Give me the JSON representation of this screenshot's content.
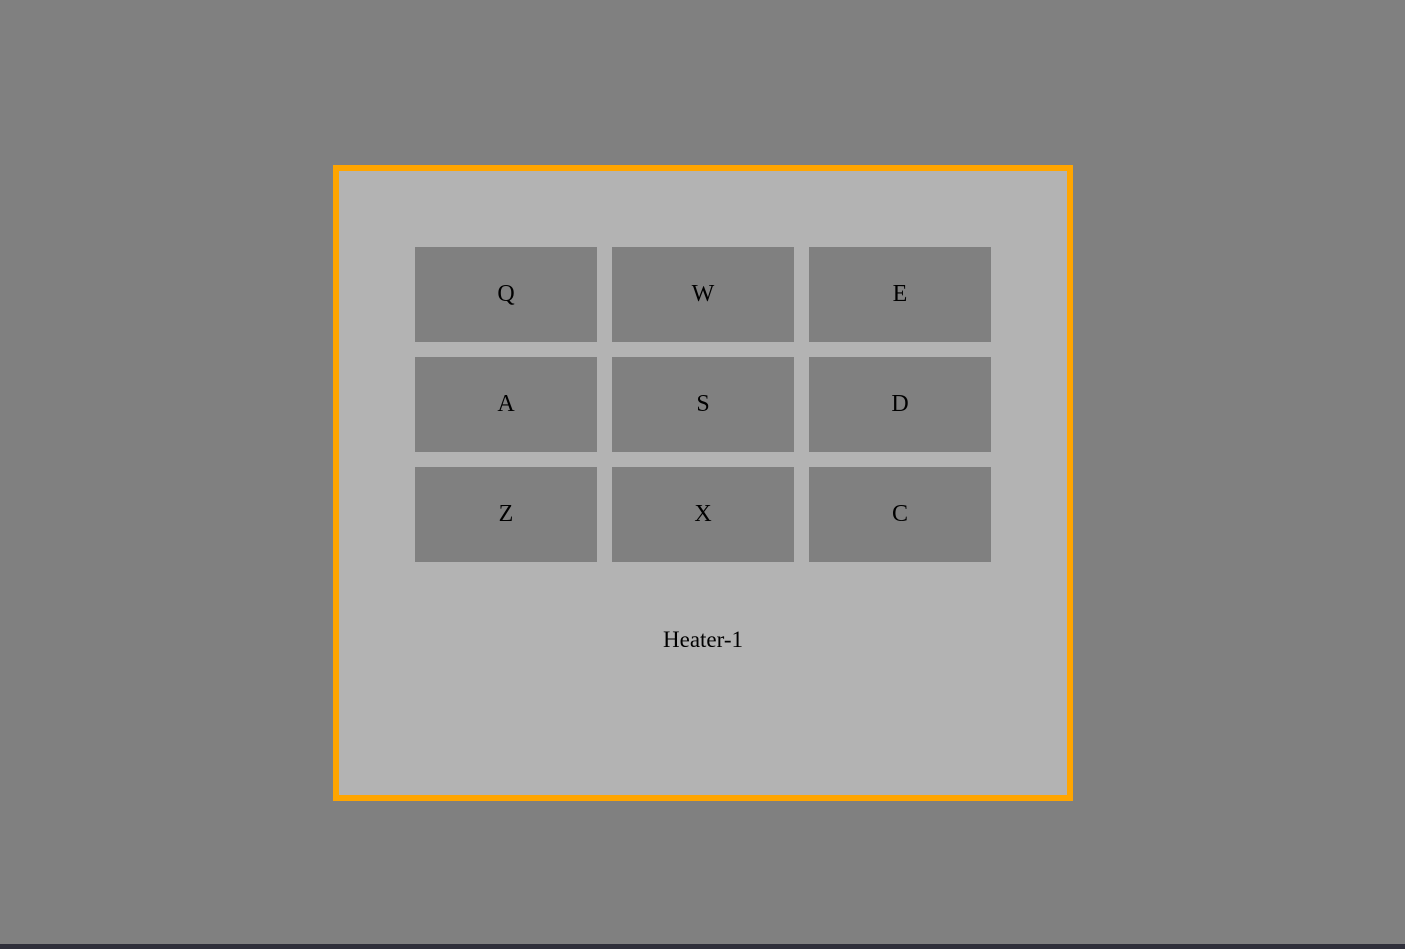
{
  "pads": [
    {
      "key": "Q"
    },
    {
      "key": "W"
    },
    {
      "key": "E"
    },
    {
      "key": "A"
    },
    {
      "key": "S"
    },
    {
      "key": "D"
    },
    {
      "key": "Z"
    },
    {
      "key": "X"
    },
    {
      "key": "C"
    }
  ],
  "display": {
    "text": "Heater-1"
  },
  "colors": {
    "background": "#808080",
    "panel": "#b3b3b3",
    "border": "#ffa500",
    "pad": "#808080"
  }
}
